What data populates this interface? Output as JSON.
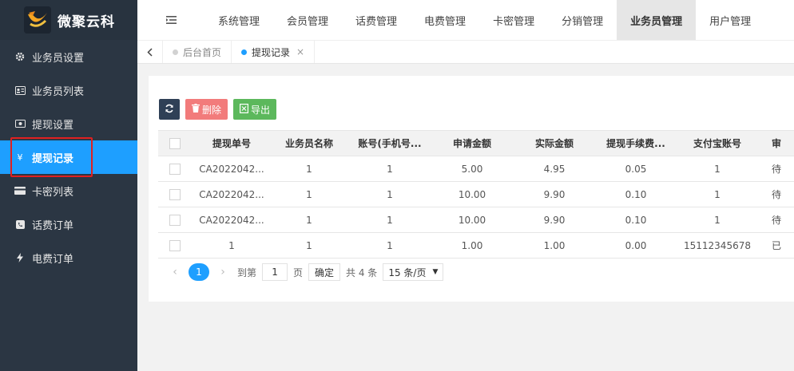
{
  "app": {
    "logo_text": "微聚云科",
    "colors": {
      "sidebar": "#2b3643",
      "accent": "#1e9fff",
      "delete": "#f27b7b",
      "export": "#5cb85c"
    }
  },
  "sidebar": {
    "items": [
      {
        "label": "业务员设置",
        "icon": "gear-icon"
      },
      {
        "label": "业务员列表",
        "icon": "id-card-icon"
      },
      {
        "label": "提现设置",
        "icon": "cash-icon"
      },
      {
        "label": "提现记录",
        "icon": "yen-icon",
        "active": true
      },
      {
        "label": "卡密列表",
        "icon": "credit-card-icon"
      },
      {
        "label": "话费订单",
        "icon": "phone-icon"
      },
      {
        "label": "电费订单",
        "icon": "bolt-icon"
      }
    ]
  },
  "topnav": {
    "tabs": [
      {
        "label": "系统管理"
      },
      {
        "label": "会员管理"
      },
      {
        "label": "话费管理"
      },
      {
        "label": "电费管理"
      },
      {
        "label": "卡密管理"
      },
      {
        "label": "分销管理"
      },
      {
        "label": "业务员管理",
        "active": true
      },
      {
        "label": "用户管理"
      }
    ]
  },
  "tabbar": {
    "tabs": [
      {
        "label": "后台首页"
      },
      {
        "label": "提现记录",
        "active": true,
        "close": "×"
      }
    ]
  },
  "toolbar": {
    "delete_label": "删除",
    "export_label": "导出"
  },
  "table": {
    "headers": [
      "提现单号",
      "业务员名称",
      "账号(手机号...",
      "申请金额",
      "实际金额",
      "提现手续费...",
      "支付宝账号",
      "审"
    ],
    "rows": [
      [
        "CA2022042...",
        "1",
        "1",
        "5.00",
        "4.95",
        "0.05",
        "1",
        "待"
      ],
      [
        "CA2022042...",
        "1",
        "1",
        "10.00",
        "9.90",
        "0.10",
        "1",
        "待"
      ],
      [
        "CA2022042...",
        "1",
        "1",
        "10.00",
        "9.90",
        "0.10",
        "1",
        "待"
      ],
      [
        "1",
        "1",
        "1",
        "1.00",
        "1.00",
        "0.00",
        "15112345678",
        "已"
      ]
    ]
  },
  "pager": {
    "current": "1",
    "goto_prefix": "到第",
    "goto_value": "1",
    "goto_suffix": "页",
    "confirm": "确定",
    "total": "共 4 条",
    "page_size": "15 条/页"
  }
}
